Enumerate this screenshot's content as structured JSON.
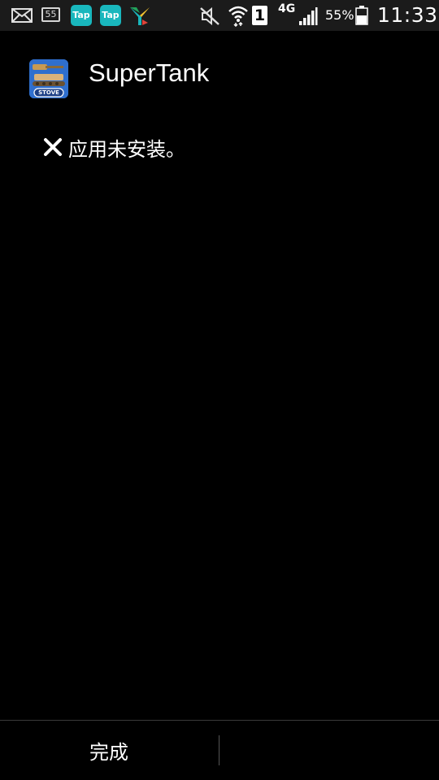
{
  "status_bar": {
    "sim_badge": "55",
    "tap_label_1": "Tap",
    "tap_label_2": "Tap",
    "sim_slot": "1",
    "network_type": "4G",
    "battery_percent": "55%",
    "battery_level": 0.55,
    "time": "11:33",
    "icons": [
      "mail-icon",
      "tap-icon",
      "tap-icon",
      "y-logo-icon",
      "mute-icon",
      "wifi-icon",
      "signal-icon",
      "battery-icon"
    ]
  },
  "app": {
    "name": "SuperTank",
    "icon_label": "STOVE"
  },
  "message": {
    "text": "应用未安装。",
    "icon": "close-icon"
  },
  "footer": {
    "done_label": "完成"
  }
}
